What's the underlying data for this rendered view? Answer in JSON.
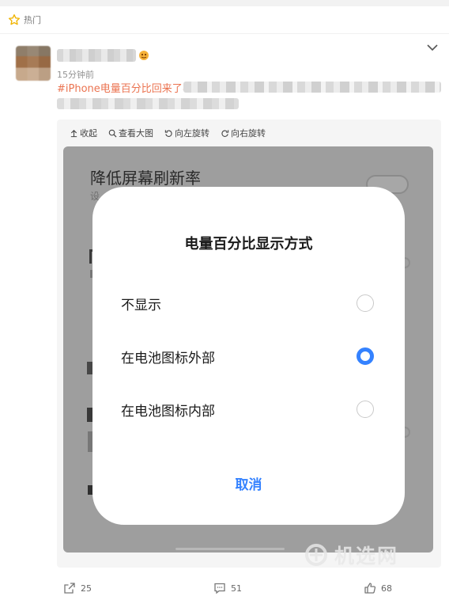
{
  "feed": {
    "section_label": "热门",
    "post": {
      "time": "15分钟前",
      "hashtag": "#iPhone电量百分比回来了#"
    }
  },
  "toolbar": {
    "collapse": "收起",
    "view_large": "查看大图",
    "rotate_left": "向左旋转",
    "rotate_right": "向右旋转"
  },
  "phone_screenshot": {
    "background_setting_title": "降低屏幕刷新率",
    "background_setting_subtitle": "设",
    "dialog": {
      "title": "电量百分比显示方式",
      "options": [
        {
          "label": "不显示",
          "selected": false
        },
        {
          "label": "在电池图标外部",
          "selected": true
        },
        {
          "label": "在电池图标内部",
          "selected": false
        }
      ],
      "cancel_label": "取消"
    }
  },
  "watermark": {
    "text": "机选网"
  },
  "actions": {
    "share_count": "25",
    "comment_count": "51",
    "like_count": "68"
  },
  "colors": {
    "hashtag": "#eb7350",
    "accent_blue": "#3482ff",
    "star": "#f0b400"
  }
}
